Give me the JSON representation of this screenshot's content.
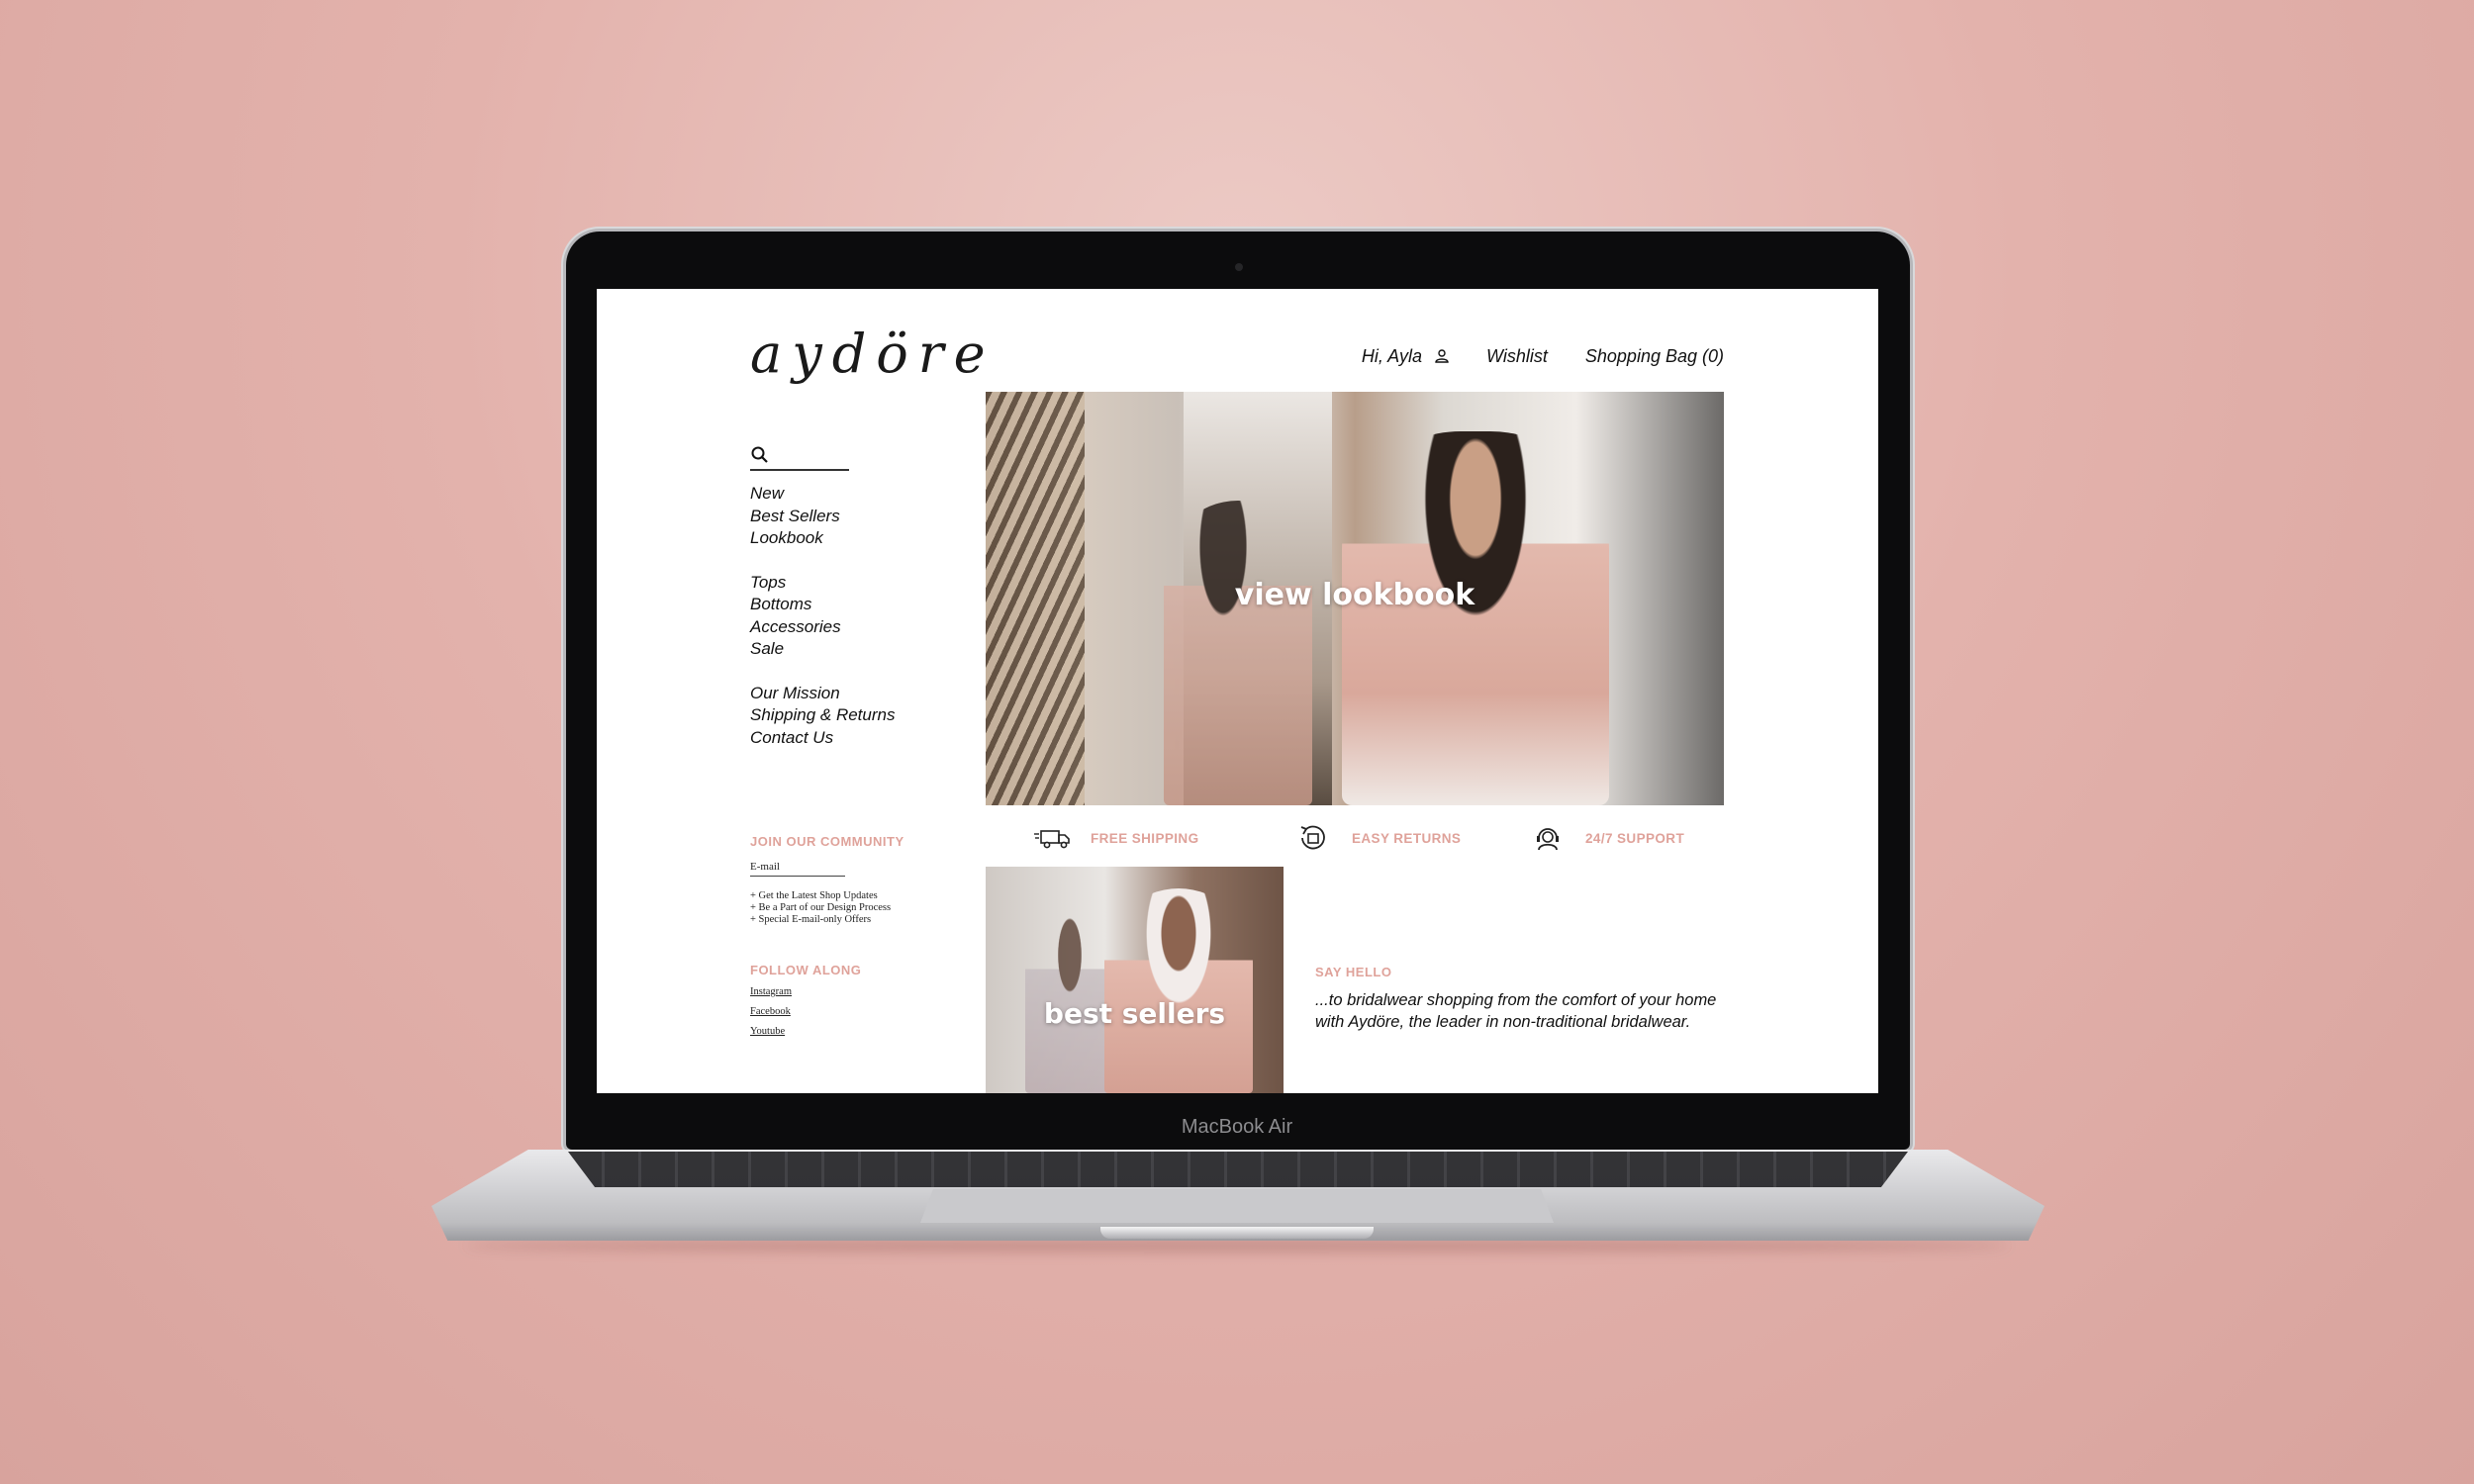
{
  "device": {
    "label": "MacBook Air"
  },
  "site": {
    "logo": "aydöre",
    "topnav": {
      "greeting": "Hi, Ayla",
      "wishlist": "Wishlist",
      "bag": "Shopping Bag (0)"
    },
    "sidenav": {
      "group1": [
        "New",
        "Best Sellers",
        "Lookbook"
      ],
      "group2": [
        "Tops",
        "Bottoms",
        "Accessories",
        "Sale"
      ],
      "group3": [
        "Our Mission",
        "Shipping & Returns",
        "Contact Us"
      ]
    },
    "community": {
      "heading": "JOIN OUR COMMUNITY",
      "email_placeholder": "E-mail",
      "perks": [
        "+ Get the Latest Shop Updates",
        "+ Be a Part of our Design Process",
        "+ Special E-mail-only Offers"
      ]
    },
    "follow": {
      "heading": "FOLLOW ALONG",
      "links": [
        "Instagram",
        "Facebook",
        "Youtube"
      ]
    },
    "hero": {
      "label": "view lookbook"
    },
    "features": [
      {
        "label": "FREE SHIPPING",
        "icon": "truck-icon"
      },
      {
        "label": "EASY RETURNS",
        "icon": "return-box-icon"
      },
      {
        "label": "24/7 SUPPORT",
        "icon": "headset-icon"
      }
    ],
    "tile": {
      "label": "best sellers"
    },
    "hello": {
      "heading": "SAY HELLO",
      "body": "...to bridalwear shopping from the comfort of your home with Aydöre, the leader in non-traditional bridalwear."
    },
    "colors": {
      "accent": "#dfa29a",
      "background": "#e3b2ac"
    }
  }
}
